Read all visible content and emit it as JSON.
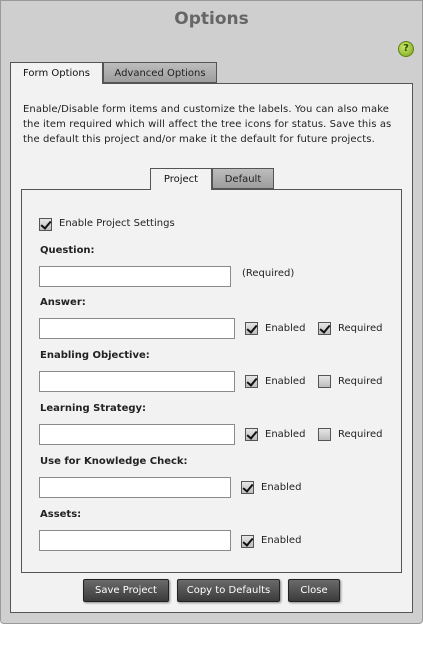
{
  "dialog": {
    "title": "Options"
  },
  "help": {
    "icon": "help-icon",
    "glyph": "?"
  },
  "tabs": [
    {
      "label": "Form Options",
      "active": true
    },
    {
      "label": "Advanced Options",
      "active": false
    }
  ],
  "description": "Enable/Disable form items and customize the labels. You can also make the item required which will affect the tree icons for status. Save this as the default this project and/or make it the default for future projects.",
  "subtabs": [
    {
      "label": "Project",
      "active": true
    },
    {
      "label": "Default",
      "active": false
    }
  ],
  "enable_project_settings": {
    "label": "Enable Project Settings",
    "checked": true
  },
  "fields": {
    "question": {
      "label": "Question:",
      "value": "",
      "note": "(Required)"
    },
    "answer": {
      "label": "Answer:",
      "value": "",
      "enabled_label": "Enabled",
      "enabled": true,
      "required_label": "Required",
      "required": true
    },
    "enabling_objective": {
      "label": "Enabling Objective:",
      "value": "",
      "enabled_label": "Enabled",
      "enabled": true,
      "required_label": "Required",
      "required": false
    },
    "learning_strategy": {
      "label": "Learning Strategy:",
      "value": "",
      "enabled_label": "Enabled",
      "enabled": true,
      "required_label": "Required",
      "required": false
    },
    "knowledge_check": {
      "label": "Use for Knowledge Check:",
      "value": "",
      "enabled_label": "Enabled",
      "enabled": true
    },
    "assets": {
      "label": "Assets:",
      "value": "",
      "enabled_label": "Enabled",
      "enabled": true
    }
  },
  "buttons": {
    "save": "Save Project",
    "copy": "Copy to Defaults",
    "close": "Close"
  },
  "colors": {
    "dialog_bg": "#cfcfcf",
    "panel_bg": "#f2f2f2",
    "button_bg": "#4a4a4a",
    "help_green": "#7aa51c"
  }
}
